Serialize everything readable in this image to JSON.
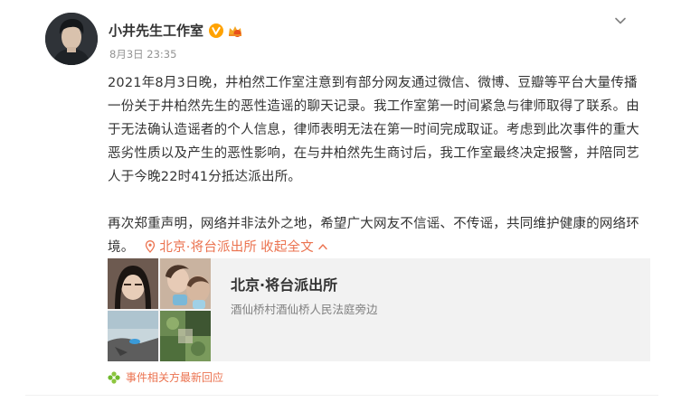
{
  "author": {
    "name": "小井先生工作室",
    "time": "8月3日 23:35",
    "verified_color": "#ffa200"
  },
  "post": {
    "paragraph1": "2021年8月3日晚，井柏然工作室注意到有部分网友通过微信、微博、豆瓣等平台大量传播一份关于井柏然先生的恶性造谣的聊天记录。我工作室第一时间紧急与律师取得了联系。由于无法确认造谣者的个人信息，律师表明无法在第一时间完成取证。考虑到此次事件的重大恶劣性质以及产生的恶性影响，在与井柏然先生商讨后，我工作室最终决定报警，并陪同艺人于今晚22时41分抵达派出所。",
    "paragraph2": "再次郑重声明，网络并非法外之地，希望广大网友不信谣、不传谣，共同维护健康的网络环境。",
    "location_label": "北京·将台派出所",
    "collapse_label": "收起全文",
    "location_icon": "location-pin-icon",
    "collapse_icon": "chevron-up-icon"
  },
  "place_card": {
    "title": "北京·将台派出所",
    "address": "酒仙桥村酒仙桥人民法庭旁边"
  },
  "related": {
    "label": "事件相关方最新回应",
    "icon": "pinwheel-icon"
  },
  "colors": {
    "link": "#eb7350",
    "text": "#333333",
    "muted": "#939393",
    "card_bg": "#f2f2f2"
  }
}
